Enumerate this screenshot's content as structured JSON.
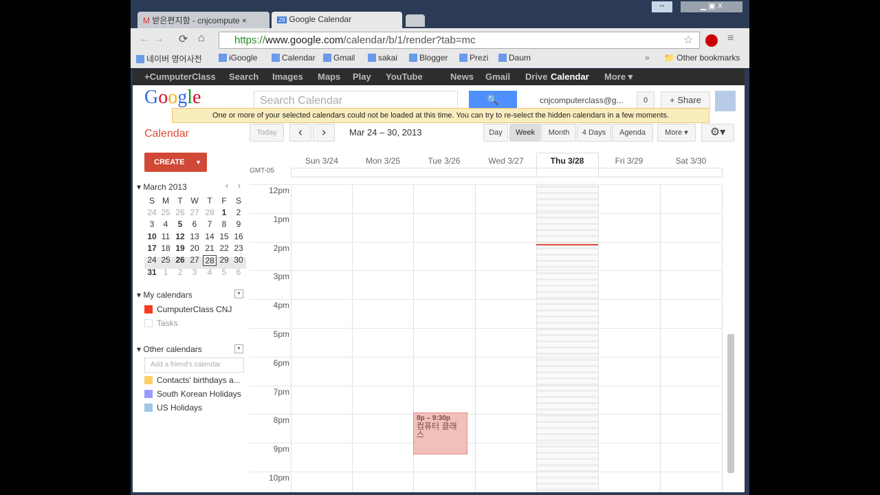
{
  "browser": {
    "tabs": [
      {
        "title": "받은편지함 - cnjcompute",
        "icon": "gmail-icon"
      },
      {
        "title": "Google Calendar",
        "icon": "calendar-icon"
      }
    ],
    "url_scheme": "https://",
    "url_host": "www.google.com",
    "url_path": "/calendar/b/1/render?tab=mc",
    "bookmarks": [
      "네이버 영어사전",
      "iGoogle",
      "Calendar",
      "Gmail",
      "sakai",
      "Blogger",
      "Prezi",
      "Daum"
    ],
    "other_bookmarks": "Other bookmarks",
    "overflow": "»"
  },
  "gbar": {
    "items": [
      "+CumputerClass",
      "Search",
      "Images",
      "Maps",
      "Play",
      "YouTube",
      "News",
      "Gmail",
      "Drive",
      "Calendar",
      "More ▾"
    ],
    "active": "Calendar"
  },
  "header": {
    "logo": "Google",
    "search_placeholder": "Search Calendar",
    "account": "cnjcomputerclass@g...",
    "notif_count": "0",
    "share": "+ Share"
  },
  "warning": "One or more of your selected calendars could not be loaded at this time. You can try to re-select the hidden calendars in a few moments.",
  "app_title": "Calendar",
  "nav": {
    "today": "Today",
    "prev": "‹",
    "next": "›",
    "range": "Mar 24 – 30, 2013",
    "views": [
      "Day",
      "Week",
      "Month",
      "4 Days",
      "Agenda"
    ],
    "active_view": "Week",
    "more": "More ▾",
    "settings": "⚙▾"
  },
  "create": {
    "label": "CREATE",
    "dropdown": "▼"
  },
  "mini": {
    "title": "March 2013",
    "prev": "‹",
    "next": "›",
    "weekdays": [
      "S",
      "M",
      "T",
      "W",
      "T",
      "F",
      "S"
    ],
    "weeks": [
      [
        "24",
        "25",
        "26",
        "27",
        "28",
        "1",
        "2"
      ],
      [
        "3",
        "4",
        "5",
        "6",
        "7",
        "8",
        "9"
      ],
      [
        "10",
        "11",
        "12",
        "13",
        "14",
        "15",
        "16"
      ],
      [
        "17",
        "18",
        "19",
        "20",
        "21",
        "22",
        "23"
      ],
      [
        "24",
        "25",
        "26",
        "27",
        "28",
        "29",
        "30"
      ],
      [
        "31",
        "1",
        "2",
        "3",
        "4",
        "5",
        "6"
      ]
    ],
    "today": "28"
  },
  "my_calendars": {
    "title": "My calendars",
    "items": [
      {
        "name": "CumputerClass CNJ",
        "color": "#f83a22"
      },
      {
        "name": "Tasks",
        "color": "#ffffff"
      }
    ]
  },
  "other_calendars": {
    "title": "Other calendars",
    "add_placeholder": "Add a friend's calendar",
    "items": [
      {
        "name": "Contacts' birthdays a...",
        "color": "#fad165"
      },
      {
        "name": "South Korean Holidays",
        "color": "#9a9cff"
      },
      {
        "name": "US Holidays",
        "color": "#9fc6e7"
      }
    ]
  },
  "grid": {
    "timezone": "GMT-05",
    "days": [
      "Sun 3/24",
      "Mon 3/25",
      "Tue 3/26",
      "Wed 3/27",
      "Thu 3/28",
      "Fri 3/29",
      "Sat 3/30"
    ],
    "today": "Thu 3/28",
    "hours": [
      "12pm",
      "1pm",
      "2pm",
      "3pm",
      "4pm",
      "5pm",
      "6pm",
      "7pm",
      "8pm",
      "9pm",
      "10pm"
    ]
  },
  "event": {
    "time": "8p – 9:30p",
    "title": "컴퓨터 클래스",
    "day": "Tue 3/26",
    "color": "#f2c0bb"
  }
}
